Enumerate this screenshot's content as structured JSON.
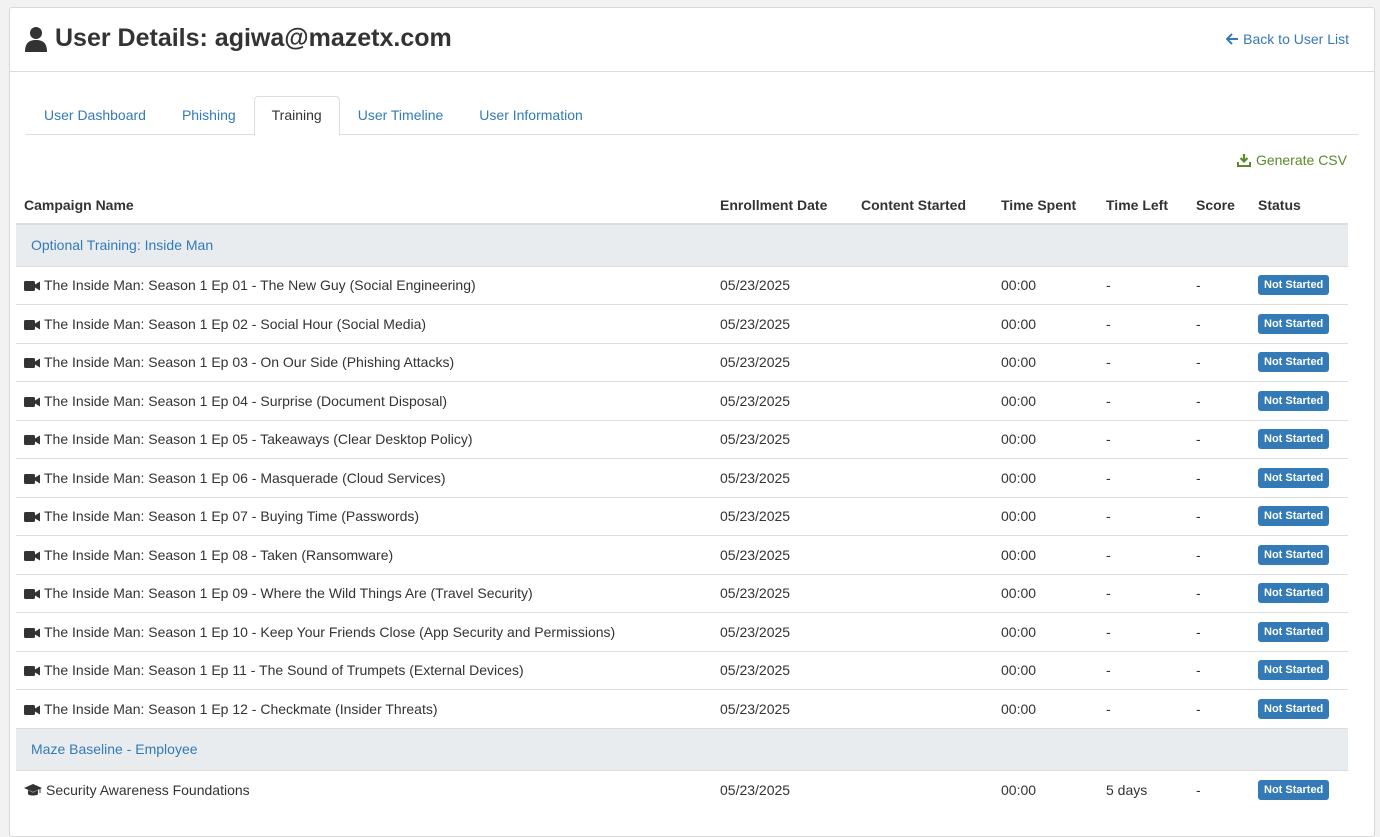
{
  "header": {
    "title": "User Details: agiwa@mazetx.com",
    "back_label": "Back to User List"
  },
  "tabs": [
    {
      "label": "User Dashboard",
      "active": false
    },
    {
      "label": "Phishing",
      "active": false
    },
    {
      "label": "Training",
      "active": true
    },
    {
      "label": "User Timeline",
      "active": false
    },
    {
      "label": "User Information",
      "active": false
    }
  ],
  "actions": {
    "csv_label": "Generate CSV"
  },
  "table": {
    "columns": [
      "Campaign Name",
      "Enrollment Date",
      "Content Started",
      "Time Spent",
      "Time Left",
      "Score",
      "Status"
    ],
    "groups": [
      {
        "name": "Optional Training: Inside Man",
        "rows": [
          {
            "icon": "video-camera-icon",
            "name": "The Inside Man: Season 1 Ep 01 - The New Guy (Social Engineering)",
            "enrollment": "05/23/2025",
            "started": "",
            "spent": "00:00",
            "left": "-",
            "score": "-",
            "status": "Not Started"
          },
          {
            "icon": "video-camera-icon",
            "name": "The Inside Man: Season 1 Ep 02 - Social Hour (Social Media)",
            "enrollment": "05/23/2025",
            "started": "",
            "spent": "00:00",
            "left": "-",
            "score": "-",
            "status": "Not Started"
          },
          {
            "icon": "video-camera-icon",
            "name": "The Inside Man: Season 1 Ep 03 - On Our Side (Phishing Attacks)",
            "enrollment": "05/23/2025",
            "started": "",
            "spent": "00:00",
            "left": "-",
            "score": "-",
            "status": "Not Started"
          },
          {
            "icon": "video-camera-icon",
            "name": "The Inside Man: Season 1 Ep 04 - Surprise (Document Disposal)",
            "enrollment": "05/23/2025",
            "started": "",
            "spent": "00:00",
            "left": "-",
            "score": "-",
            "status": "Not Started"
          },
          {
            "icon": "video-camera-icon",
            "name": "The Inside Man: Season 1 Ep 05 - Takeaways (Clear Desktop Policy)",
            "enrollment": "05/23/2025",
            "started": "",
            "spent": "00:00",
            "left": "-",
            "score": "-",
            "status": "Not Started"
          },
          {
            "icon": "video-camera-icon",
            "name": "The Inside Man: Season 1 Ep 06 - Masquerade (Cloud Services)",
            "enrollment": "05/23/2025",
            "started": "",
            "spent": "00:00",
            "left": "-",
            "score": "-",
            "status": "Not Started"
          },
          {
            "icon": "video-camera-icon",
            "name": "The Inside Man: Season 1 Ep 07 - Buying Time (Passwords)",
            "enrollment": "05/23/2025",
            "started": "",
            "spent": "00:00",
            "left": "-",
            "score": "-",
            "status": "Not Started"
          },
          {
            "icon": "video-camera-icon",
            "name": "The Inside Man: Season 1 Ep 08 - Taken (Ransomware)",
            "enrollment": "05/23/2025",
            "started": "",
            "spent": "00:00",
            "left": "-",
            "score": "-",
            "status": "Not Started"
          },
          {
            "icon": "video-camera-icon",
            "name": "The Inside Man: Season 1 Ep 09 - Where the Wild Things Are (Travel Security)",
            "enrollment": "05/23/2025",
            "started": "",
            "spent": "00:00",
            "left": "-",
            "score": "-",
            "status": "Not Started"
          },
          {
            "icon": "video-camera-icon",
            "name": "The Inside Man: Season 1 Ep 10 - Keep Your Friends Close (App Security and Permissions)",
            "enrollment": "05/23/2025",
            "started": "",
            "spent": "00:00",
            "left": "-",
            "score": "-",
            "status": "Not Started"
          },
          {
            "icon": "video-camera-icon",
            "name": "The Inside Man: Season 1 Ep 11 - The Sound of Trumpets (External Devices)",
            "enrollment": "05/23/2025",
            "started": "",
            "spent": "00:00",
            "left": "-",
            "score": "-",
            "status": "Not Started"
          },
          {
            "icon": "video-camera-icon",
            "name": "The Inside Man: Season 1 Ep 12 - Checkmate (Insider Threats)",
            "enrollment": "05/23/2025",
            "started": "",
            "spent": "00:00",
            "left": "-",
            "score": "-",
            "status": "Not Started"
          }
        ]
      },
      {
        "name": "Maze Baseline - Employee",
        "rows": [
          {
            "icon": "graduation-cap-icon",
            "name": "Security Awareness Foundations",
            "enrollment": "05/23/2025",
            "started": "",
            "spent": "00:00",
            "left": "5 days",
            "score": "-",
            "status": "Not Started"
          }
        ]
      }
    ]
  },
  "colors": {
    "link": "#337ab7",
    "badge": "#337ab7",
    "csv": "#5a8a2a",
    "group_bg": "#e9ecef"
  }
}
